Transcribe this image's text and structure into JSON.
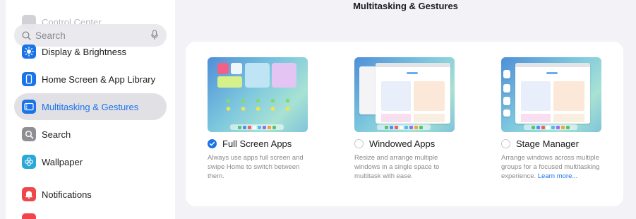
{
  "sidebar": {
    "faded_item": "Control Center",
    "search": {
      "placeholder": "Search"
    },
    "items": [
      {
        "label": "Display & Brightness",
        "icon": "sun-icon",
        "color": "#1a73e8"
      },
      {
        "label": "Home Screen & App Library",
        "icon": "phone-grid-icon",
        "color": "#1a73e8"
      },
      {
        "label": "Multitasking & Gestures",
        "icon": "multitasking-icon",
        "color": "#1a73e8",
        "selected": true
      },
      {
        "label": "Search",
        "icon": "magnifier-icon",
        "color": "#8e8e93"
      },
      {
        "label": "Wallpaper",
        "icon": "flower-icon",
        "color": "#2aa8d8"
      },
      {
        "label": "Notifications",
        "icon": "bell-icon",
        "color": "#f0454a"
      }
    ]
  },
  "main": {
    "title": "Multitasking & Gestures",
    "options": [
      {
        "title": "Full Screen Apps",
        "description": "Always use apps full screen and swipe Home to switch between them.",
        "selected": true
      },
      {
        "title": "Windowed Apps",
        "description": "Resize and arrange multiple windows in a single space to multitask with ease.",
        "selected": false
      },
      {
        "title": "Stage Manager",
        "description": "Arrange windows across multiple groups for a focused multitasking experience.",
        "link": "Learn more...",
        "selected": false
      }
    ]
  },
  "colors": {
    "accent": "#1a73e8",
    "background": "#f2f2f7"
  }
}
